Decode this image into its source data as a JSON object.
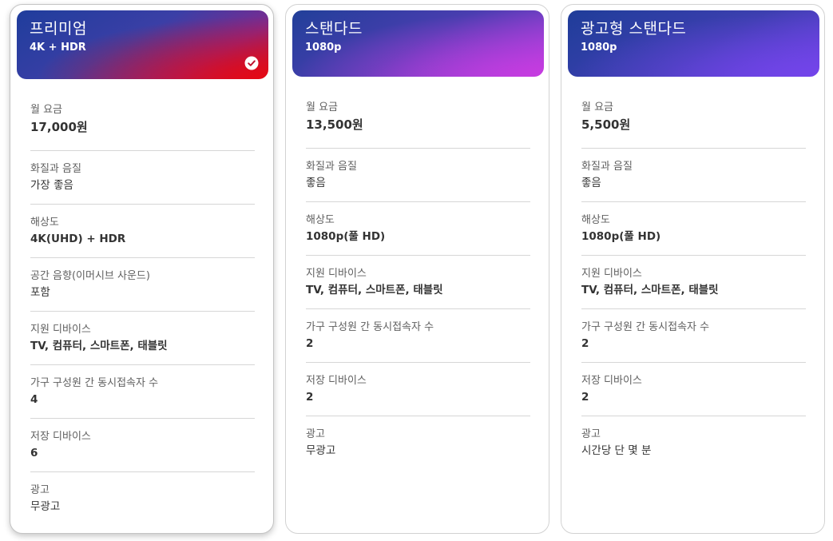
{
  "plans": [
    {
      "name": "프리미엄",
      "quality": "4K + HDR",
      "selected": true,
      "accent_colors": [
        "#1f3d9c",
        "#e50914"
      ],
      "features": [
        {
          "label": "월 요금",
          "value": "17,000원"
        },
        {
          "label": "화질과 음질",
          "value": "가장 좋음"
        },
        {
          "label": "해상도",
          "value": "4K(UHD) + HDR"
        },
        {
          "label": "공간 음향(이머시브 사운드)",
          "value": "포함"
        },
        {
          "label": "지원 디바이스",
          "value": "TV, 컴퓨터, 스마트폰, 태블릿"
        },
        {
          "label": "가구 구성원 간 동시접속자 수",
          "value": "4"
        },
        {
          "label": "저장 디바이스",
          "value": "6"
        },
        {
          "label": "광고",
          "value": "무광고"
        }
      ]
    },
    {
      "name": "스탠다드",
      "quality": "1080p",
      "selected": false,
      "accent_colors": [
        "#213f99",
        "#c63ce0"
      ],
      "features": [
        {
          "label": "월 요금",
          "value": "13,500원"
        },
        {
          "label": "화질과 음질",
          "value": "좋음"
        },
        {
          "label": "해상도",
          "value": "1080p(풀 HD)"
        },
        {
          "label": "지원 디바이스",
          "value": "TV, 컴퓨터, 스마트폰, 태블릿"
        },
        {
          "label": "가구 구성원 간 동시접속자 수",
          "value": "2"
        },
        {
          "label": "저장 디바이스",
          "value": "2"
        },
        {
          "label": "광고",
          "value": "무광고"
        }
      ]
    },
    {
      "name": "광고형 스탠다드",
      "quality": "1080p",
      "selected": false,
      "accent_colors": [
        "#1f3d99",
        "#7344ea"
      ],
      "features": [
        {
          "label": "월 요금",
          "value": "5,500원"
        },
        {
          "label": "화질과 음질",
          "value": "좋음"
        },
        {
          "label": "해상도",
          "value": "1080p(풀 HD)"
        },
        {
          "label": "지원 디바이스",
          "value": "TV, 컴퓨터, 스마트폰, 태블릿"
        },
        {
          "label": "가구 구성원 간 동시접속자 수",
          "value": "2"
        },
        {
          "label": "저장 디바이스",
          "value": "2"
        },
        {
          "label": "광고",
          "value": "시간당 단 몇 분"
        }
      ]
    }
  ],
  "icons": {
    "selected_check": "check-circle-icon"
  }
}
